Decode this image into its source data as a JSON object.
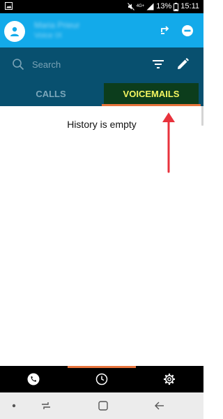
{
  "status_bar": {
    "network_label": "4G+",
    "battery_percent": "13%",
    "time": "15:11",
    "icons": [
      "image-notification-icon",
      "mute-icon",
      "signal-icon",
      "battery-icon"
    ]
  },
  "header": {
    "user_name": "Maria Prieur",
    "user_status": "Voice IX",
    "icons": [
      "avatar-icon",
      "transfer-icon",
      "dnd-icon"
    ]
  },
  "search": {
    "placeholder": "Search",
    "icons": [
      "search-icon",
      "filter-icon",
      "edit-icon"
    ]
  },
  "tabs": [
    {
      "label": "CALLS",
      "active": false
    },
    {
      "label": "VOICEMAILS",
      "active": true
    }
  ],
  "content": {
    "empty_message": "History is empty"
  },
  "bottom_nav": {
    "items": [
      "phone-icon",
      "history-icon",
      "settings-icon"
    ],
    "active_index": 1
  },
  "system_nav": {
    "items": [
      "dot-icon",
      "recent-apps-icon",
      "home-icon",
      "back-icon"
    ]
  },
  "colors": {
    "header_bg": "#13aaea",
    "toolbar_bg": "#08506f",
    "active_tab_bg": "#0c3d1c",
    "active_tab_text": "#f3f560",
    "indicator": "#e7743c",
    "annotation_arrow": "#e8323c"
  }
}
